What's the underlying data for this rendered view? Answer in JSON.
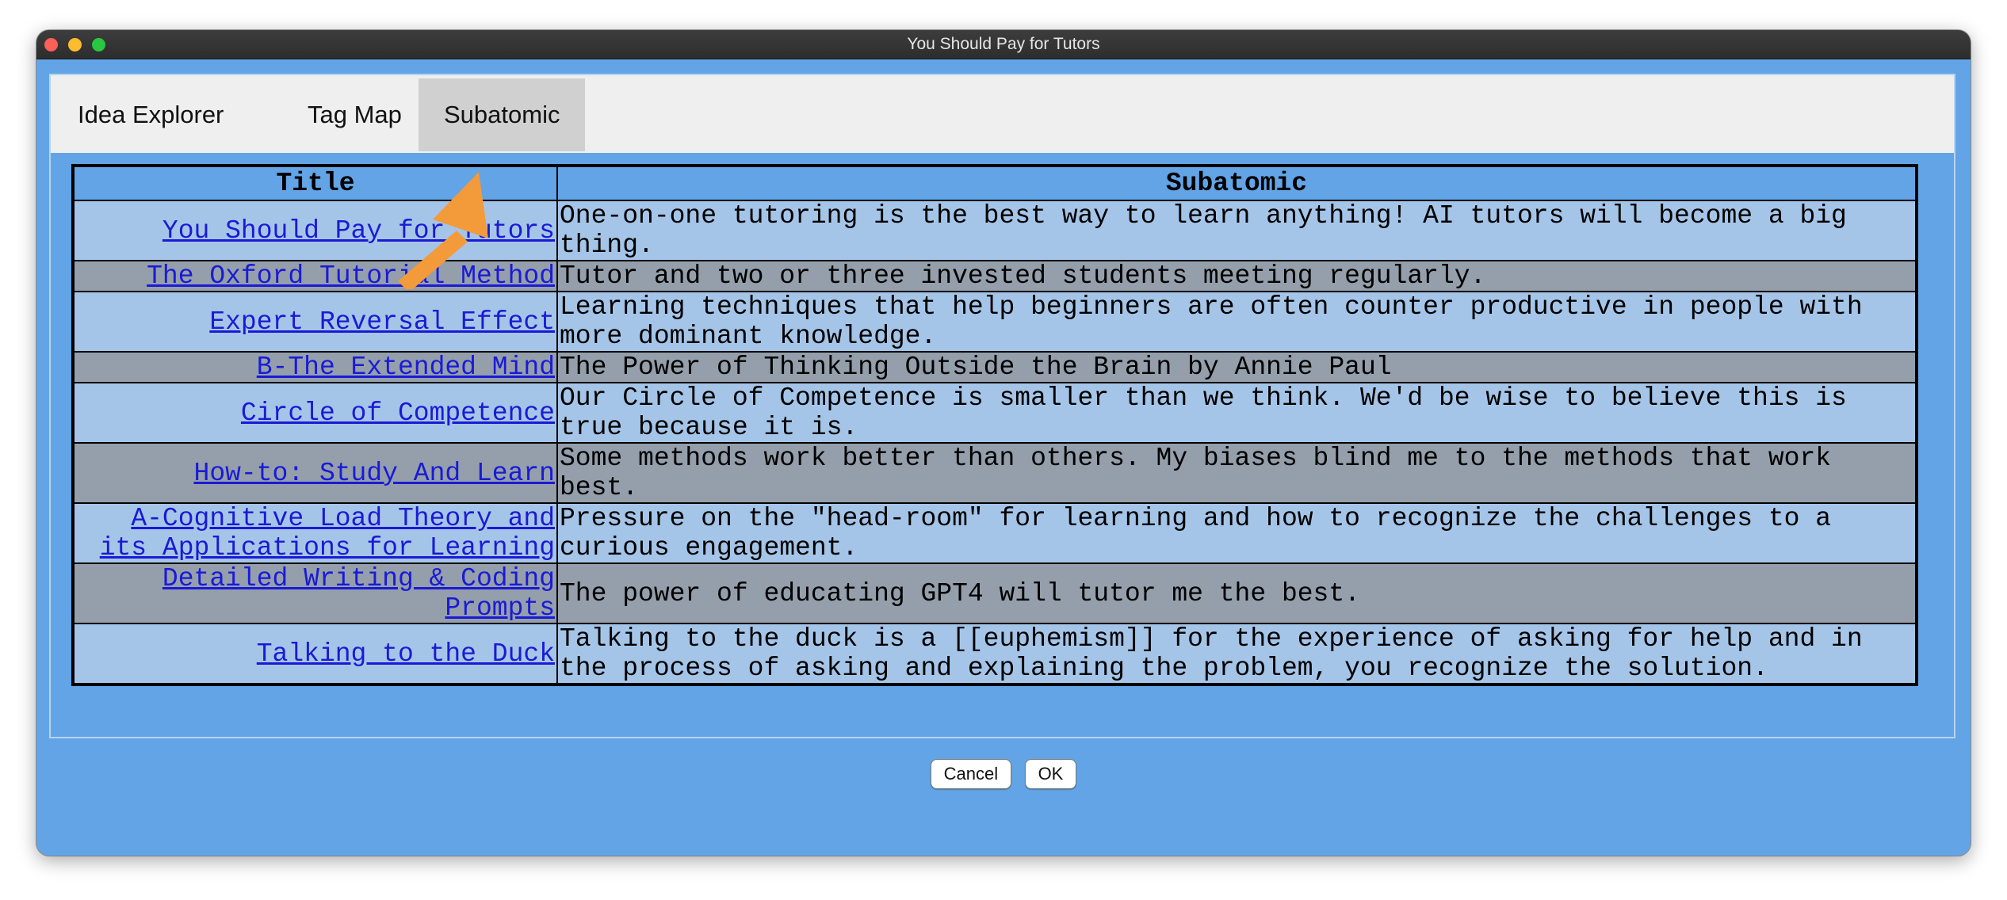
{
  "window": {
    "title": "You Should Pay for Tutors"
  },
  "tabs": [
    {
      "label": "Idea Explorer",
      "selected": false
    },
    {
      "label": "Tag Map",
      "selected": false
    },
    {
      "label": "Subatomic",
      "selected": true
    }
  ],
  "table": {
    "headers": {
      "title": "Title",
      "subatomic": "Subatomic"
    },
    "rows": [
      {
        "title": "You Should Pay for Tutors",
        "subatomic": "One-on-one tutoring is the best way to learn anything! AI tutors will become a big thing."
      },
      {
        "title": "The Oxford Tutorial Method",
        "subatomic": "Tutor and two or three invested students meeting regularly."
      },
      {
        "title": "Expert Reversal Effect",
        "subatomic": "Learning techniques that help beginners are often counter productive in people with more dominant knowledge."
      },
      {
        "title": "B-The Extended Mind",
        "subatomic": "The Power of Thinking Outside the Brain by Annie Paul"
      },
      {
        "title": "Circle of Competence",
        "subatomic": "Our Circle of Competence is smaller than we think. We'd be wise to believe this is true because it is."
      },
      {
        "title": "How-to: Study And Learn",
        "subatomic": "Some methods work better than others. My biases blind me to the methods that work best."
      },
      {
        "title": "A-Cognitive Load Theory and its Applications for Learning",
        "subatomic": "Pressure on the \"head-room\" for learning and how to recognize the challenges to a curious engagement."
      },
      {
        "title": "Detailed Writing & Coding Prompts",
        "subatomic": "The power of educating GPT4 will tutor me the best."
      },
      {
        "title": "Talking to the Duck",
        "subatomic": "Talking to the duck is a [[euphemism]] for the experience of asking for help and in the process of asking and explaining the problem, you recognize the solution."
      }
    ]
  },
  "buttons": {
    "cancel": "Cancel",
    "ok": "OK"
  },
  "colors": {
    "window_bg": "#62a4e6",
    "row_light": "#a5c5e8",
    "row_dark": "#949fab",
    "link": "#1a1ad6",
    "arrow": "#f39a3a"
  }
}
